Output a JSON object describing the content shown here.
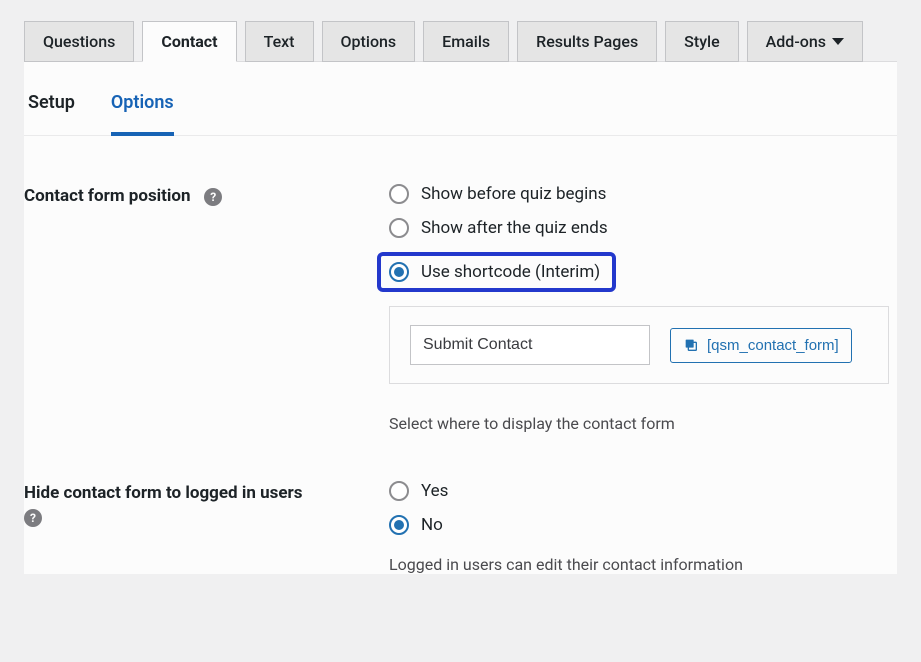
{
  "topTabs": {
    "questions": "Questions",
    "contact": "Contact",
    "text": "Text",
    "options": "Options",
    "emails": "Emails",
    "results_pages": "Results Pages",
    "style": "Style",
    "add_ons": "Add-ons"
  },
  "subTabs": {
    "setup": "Setup",
    "options": "Options"
  },
  "fields": {
    "contact_position": {
      "label": "Contact form position",
      "options": {
        "before": "Show before quiz begins",
        "after": "Show after the quiz ends",
        "shortcode": "Use shortcode (Interim)"
      },
      "submit_value": "Submit Contact",
      "shortcode_text": "[qsm_contact_form]",
      "help": "Select where to display the contact form"
    },
    "hide_logged_in": {
      "label": "Hide contact form to logged in users",
      "options": {
        "yes": "Yes",
        "no": "No"
      },
      "help": "Logged in users can edit their contact information"
    }
  }
}
